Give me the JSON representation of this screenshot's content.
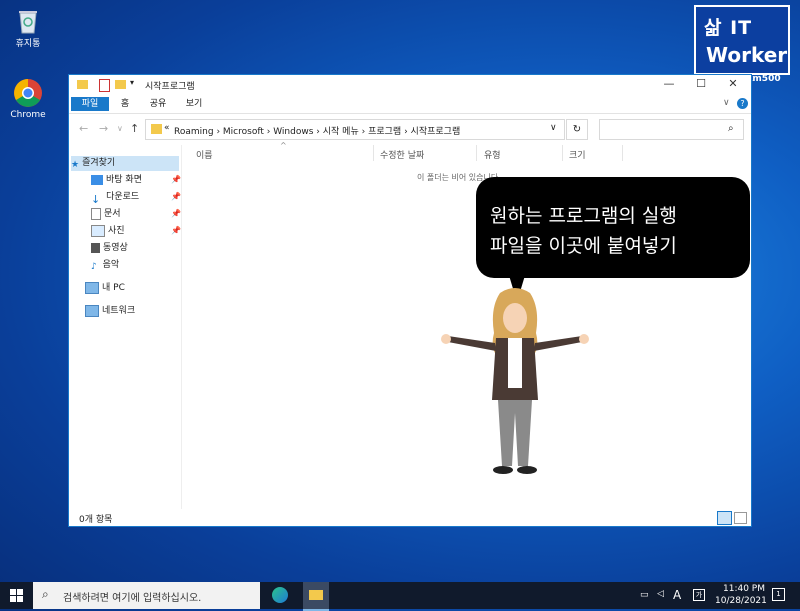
{
  "desktop": {
    "icons": [
      {
        "label": "휴지통",
        "icon": "recycle-bin-icon"
      },
      {
        "label": "Chrome",
        "icon": "chrome-icon"
      }
    ],
    "logo": {
      "line1": "삶 IT",
      "line2": "Worker",
      "credit": "bkm500"
    }
  },
  "window": {
    "title": "시작프로그램",
    "ribbon_tabs": [
      "파일",
      "홈",
      "공유",
      "보기"
    ],
    "address": {
      "overflow": "«",
      "crumbs": [
        "Roaming",
        "Microsoft",
        "Windows",
        "시작 메뉴",
        "프로그램",
        "시작프로그램"
      ]
    },
    "nav": {
      "quick_access": "즐겨찾기",
      "items": [
        {
          "label": "바탕 화면",
          "icon": "desktop-icon",
          "pinned": true
        },
        {
          "label": "다운로드",
          "icon": "download-icon",
          "pinned": true
        },
        {
          "label": "문서",
          "icon": "document-icon",
          "pinned": true
        },
        {
          "label": "사진",
          "icon": "picture-icon",
          "pinned": true
        },
        {
          "label": "동영상",
          "icon": "video-icon",
          "pinned": false
        },
        {
          "label": "음악",
          "icon": "music-icon",
          "pinned": false
        }
      ],
      "this_pc": "내 PC",
      "network": "네트워크"
    },
    "columns": [
      "이름",
      "수정한 날짜",
      "유형",
      "크기"
    ],
    "empty_message": "이 폴더는 비어 있습니다.",
    "status": "0개 항목"
  },
  "callout": {
    "line1": "원하는 프로그램의 실행",
    "line2": "파일을 이곳에 붙여넣기"
  },
  "taskbar": {
    "search_placeholder": "검색하려면 여기에 입력하십시오.",
    "ime": "A",
    "time": "11:40 PM",
    "date": "10/28/2021"
  },
  "colors": {
    "accent": "#1979ca",
    "taskbar": "#101a2c",
    "desktop": "#0f5fc4"
  }
}
